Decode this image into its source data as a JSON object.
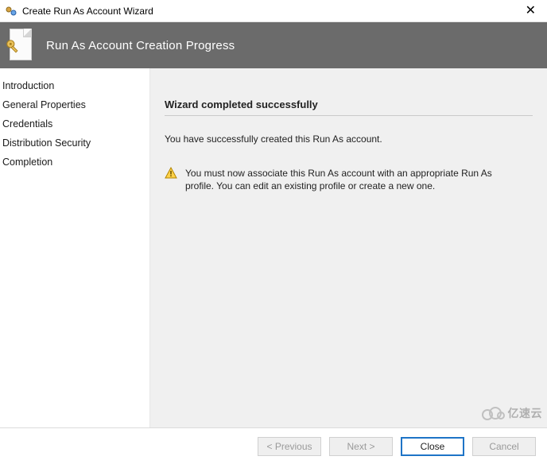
{
  "titlebar": {
    "title": "Create Run As Account Wizard"
  },
  "banner": {
    "heading": "Run As Account Creation Progress"
  },
  "sidebar": {
    "items": [
      {
        "label": "Introduction"
      },
      {
        "label": "General Properties"
      },
      {
        "label": "Credentials"
      },
      {
        "label": "Distribution Security"
      },
      {
        "label": "Completion"
      }
    ]
  },
  "content": {
    "heading": "Wizard completed successfully",
    "success_message": "You have successfully created this Run As account.",
    "warning_message": "You must now associate this Run As account with an appropriate Run As profile. You can edit an existing profile or create a new one."
  },
  "footer": {
    "previous": "< Previous",
    "next": "Next >",
    "close": "Close",
    "cancel": "Cancel"
  },
  "watermark": {
    "text": "亿速云"
  }
}
